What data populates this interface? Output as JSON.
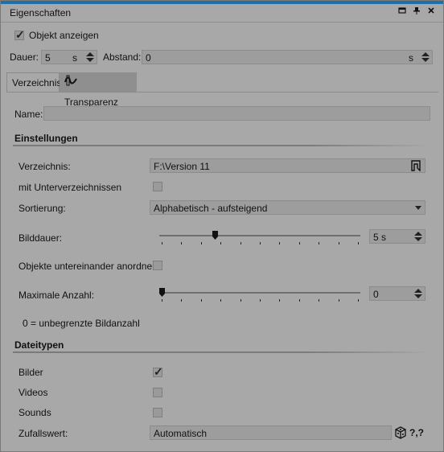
{
  "window": {
    "title": "Eigenschaften"
  },
  "top": {
    "show_object_label": "Objekt anzeigen",
    "show_object_checked": true,
    "duration_label": "Dauer:",
    "duration_value": "5",
    "duration_unit": "s",
    "distance_label": "Abstand:",
    "distance_value": "0",
    "distance_unit": "s"
  },
  "tabs": [
    {
      "label": "Verzeichnis",
      "active": true
    },
    {
      "label": "Transparenz",
      "active": false,
      "icon": "transparency-icon"
    }
  ],
  "name": {
    "label": "Name:",
    "value": ""
  },
  "settings": {
    "heading": "Einstellungen",
    "directory_label": "Verzeichnis:",
    "directory_value": "F:\\Version 11",
    "subdirs_label": "mit Unterverzeichnissen",
    "subdirs_checked": false,
    "sort_label": "Sortierung:",
    "sort_value": "Alphabetisch - aufsteigend",
    "image_duration_label": "Bilddauer:",
    "image_duration_value": "5 s",
    "image_duration_slider": 0.27,
    "stack_label": "Objekte untereinander anordnen",
    "stack_checked": false,
    "max_count_label": "Maximale Anzahl:",
    "max_count_value": "0",
    "max_count_slider": 0.0,
    "max_hint": "0 = unbegrenzte Bildanzahl"
  },
  "filetypes": {
    "heading": "Dateitypen",
    "images_label": "Bilder",
    "images_checked": true,
    "videos_label": "Videos",
    "videos_checked": false,
    "sounds_label": "Sounds",
    "sounds_checked": false,
    "random_label": "Zufallswert:",
    "random_placeholder": "Automatisch",
    "random_help": "?,?"
  }
}
